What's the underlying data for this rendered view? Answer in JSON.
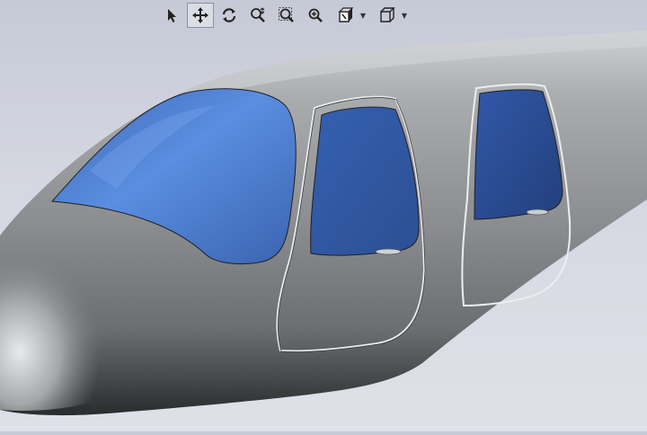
{
  "viewport": {
    "name": "3d-model-viewport",
    "model": "aircraft-fuselage-nose",
    "colors": {
      "background_top": "#c6cad6",
      "background_bottom": "#dfe1e8",
      "fuselage": "#8e9092",
      "glass": "#4a78c8"
    }
  },
  "toolbar": {
    "active_tool": "pan",
    "buttons": [
      {
        "name": "select-tool-button",
        "icon": "cursor-arrow-icon"
      },
      {
        "name": "pan-tool-button",
        "icon": "move-arrows-icon"
      },
      {
        "name": "rotate-tool-button",
        "icon": "rotate-icon"
      },
      {
        "name": "zoom-tool-button",
        "icon": "zoom-icon"
      },
      {
        "name": "zoom-area-button",
        "icon": "zoom-area-icon"
      },
      {
        "name": "zoom-fit-button",
        "icon": "zoom-fit-icon"
      },
      {
        "name": "view-orientation-button",
        "icon": "view-orientation-icon"
      },
      {
        "name": "display-style-button",
        "icon": "display-style-cube-icon"
      }
    ]
  }
}
